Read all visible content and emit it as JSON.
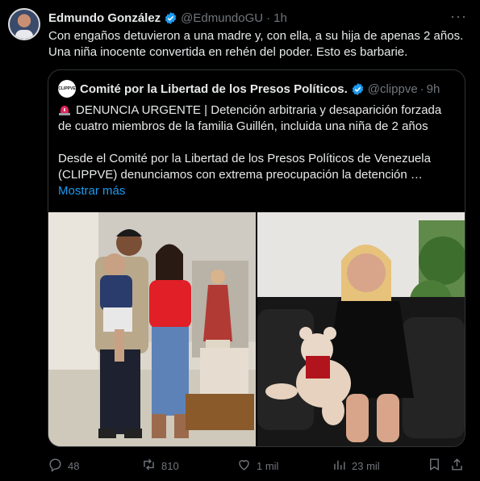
{
  "tweet": {
    "author_name": "Edmundo González",
    "handle": "@EdmundoGU",
    "separator": "·",
    "time": "1h",
    "text": "Con engaños detuvieron a una madre y, con ella, a su hija de apenas 2 años. Una niña inocente convertida en rehén del poder. Esto es barbarie."
  },
  "quoted": {
    "logo_text": "CLIPPVE",
    "author_name": "Comité por la Libertad de los Presos Políticos.",
    "handle": "@clippve",
    "separator": "·",
    "time": "9h",
    "paragraph1": "DENUNCIA URGENTE | Detención arbitraria y desaparición forzada de cuatro miembros de la familia Guillén, incluida una niña de 2 años",
    "paragraph2": "Desde el Comité por la Libertad de los Presos Políticos de Venezuela (CLIPPVE) denunciamos con extrema preocupación la detención …",
    "show_more": "Mostrar más"
  },
  "actions": {
    "replies": "48",
    "reposts": "810",
    "likes": "1 mil",
    "views": "23 mil"
  },
  "colors": {
    "background": "#000000",
    "text": "#e7e9ea",
    "muted": "#71767b",
    "accent": "#1d9bf0",
    "border": "#2f3336"
  }
}
